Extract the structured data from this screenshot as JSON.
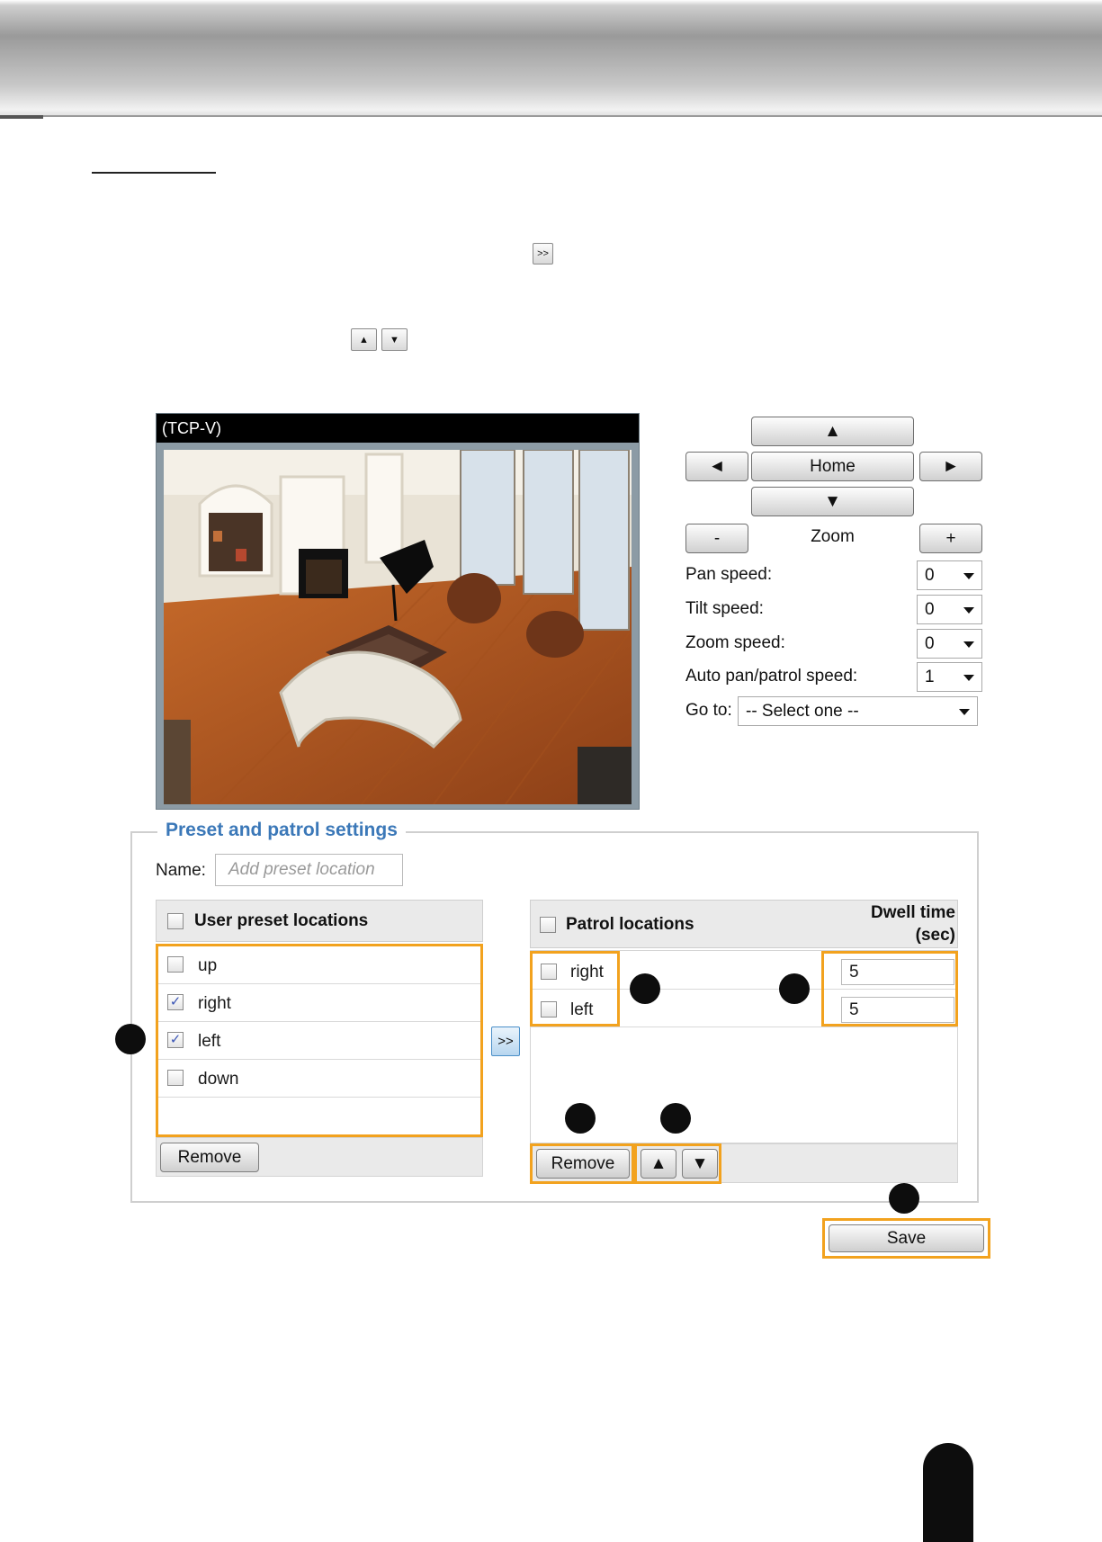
{
  "video": {
    "title": "(TCP-V)"
  },
  "inline_buttons": {
    "add_glyph": ">>",
    "up_glyph": "▲",
    "down_glyph": "▼"
  },
  "ptz": {
    "up_label": "▲",
    "left_label": "◄",
    "home_label": "Home",
    "right_label": "►",
    "down_label": "▼",
    "zoom_out_label": "-",
    "zoom_label": "Zoom",
    "zoom_in_label": "+",
    "pan_speed_label": "Pan speed:",
    "pan_speed_value": "0",
    "tilt_speed_label": "Tilt speed:",
    "tilt_speed_value": "0",
    "zoom_speed_label": "Zoom speed:",
    "zoom_speed_value": "0",
    "auto_speed_label": "Auto pan/patrol speed:",
    "auto_speed_value": "1",
    "goto_label": "Go to:",
    "goto_value": "-- Select one --"
  },
  "preset": {
    "legend": "Preset and patrol settings",
    "name_label": "Name:",
    "name_placeholder": "Add preset location",
    "user_header": "User preset locations",
    "user_items": [
      {
        "label": "up",
        "checked": false
      },
      {
        "label": "right",
        "checked": true
      },
      {
        "label": "left",
        "checked": true
      },
      {
        "label": "down",
        "checked": false
      }
    ],
    "check_mark": "✓",
    "remove_label": "Remove",
    "add_to_patrol_label": ">>",
    "patrol_header": "Patrol locations",
    "dwell_header_1": "Dwell time",
    "dwell_header_2": "(sec)",
    "patrol_items": [
      {
        "label": "right",
        "dwell": "5"
      },
      {
        "label": "left",
        "dwell": "5"
      }
    ],
    "patrol_remove_label": "Remove",
    "move_up_label": "▲",
    "move_down_label": "▼",
    "save_label": "Save"
  }
}
